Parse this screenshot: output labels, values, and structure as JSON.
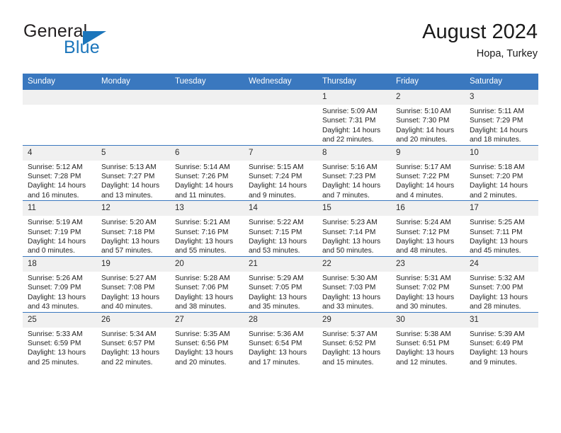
{
  "brand": {
    "line1": "General",
    "line2": "Blue",
    "accent_color": "#1b75bb"
  },
  "header": {
    "title": "August 2024",
    "location": "Hopa, Turkey"
  },
  "theme": {
    "header_bg": "#3a78bf",
    "daynum_bg": "#f0f0f0",
    "grid_line": "#3a78bf"
  },
  "calendar": {
    "weekday_headers": [
      "Sunday",
      "Monday",
      "Tuesday",
      "Wednesday",
      "Thursday",
      "Friday",
      "Saturday"
    ],
    "labels": {
      "sunrise": "Sunrise:",
      "sunset": "Sunset:",
      "daylight": "Daylight:"
    },
    "weeks": [
      [
        {
          "day": "",
          "empty": true,
          "sunrise": "",
          "sunset": "",
          "daylight_line1": "",
          "daylight_line2": ""
        },
        {
          "day": "",
          "empty": true,
          "sunrise": "",
          "sunset": "",
          "daylight_line1": "",
          "daylight_line2": ""
        },
        {
          "day": "",
          "empty": true,
          "sunrise": "",
          "sunset": "",
          "daylight_line1": "",
          "daylight_line2": ""
        },
        {
          "day": "",
          "empty": true,
          "sunrise": "",
          "sunset": "",
          "daylight_line1": "",
          "daylight_line2": ""
        },
        {
          "day": "1",
          "sunrise": "Sunrise: 5:09 AM",
          "sunset": "Sunset: 7:31 PM",
          "daylight_line1": "Daylight: 14 hours",
          "daylight_line2": "and 22 minutes."
        },
        {
          "day": "2",
          "sunrise": "Sunrise: 5:10 AM",
          "sunset": "Sunset: 7:30 PM",
          "daylight_line1": "Daylight: 14 hours",
          "daylight_line2": "and 20 minutes."
        },
        {
          "day": "3",
          "sunrise": "Sunrise: 5:11 AM",
          "sunset": "Sunset: 7:29 PM",
          "daylight_line1": "Daylight: 14 hours",
          "daylight_line2": "and 18 minutes."
        }
      ],
      [
        {
          "day": "4",
          "sunrise": "Sunrise: 5:12 AM",
          "sunset": "Sunset: 7:28 PM",
          "daylight_line1": "Daylight: 14 hours",
          "daylight_line2": "and 16 minutes."
        },
        {
          "day": "5",
          "sunrise": "Sunrise: 5:13 AM",
          "sunset": "Sunset: 7:27 PM",
          "daylight_line1": "Daylight: 14 hours",
          "daylight_line2": "and 13 minutes."
        },
        {
          "day": "6",
          "sunrise": "Sunrise: 5:14 AM",
          "sunset": "Sunset: 7:26 PM",
          "daylight_line1": "Daylight: 14 hours",
          "daylight_line2": "and 11 minutes."
        },
        {
          "day": "7",
          "sunrise": "Sunrise: 5:15 AM",
          "sunset": "Sunset: 7:24 PM",
          "daylight_line1": "Daylight: 14 hours",
          "daylight_line2": "and 9 minutes."
        },
        {
          "day": "8",
          "sunrise": "Sunrise: 5:16 AM",
          "sunset": "Sunset: 7:23 PM",
          "daylight_line1": "Daylight: 14 hours",
          "daylight_line2": "and 7 minutes."
        },
        {
          "day": "9",
          "sunrise": "Sunrise: 5:17 AM",
          "sunset": "Sunset: 7:22 PM",
          "daylight_line1": "Daylight: 14 hours",
          "daylight_line2": "and 4 minutes."
        },
        {
          "day": "10",
          "sunrise": "Sunrise: 5:18 AM",
          "sunset": "Sunset: 7:20 PM",
          "daylight_line1": "Daylight: 14 hours",
          "daylight_line2": "and 2 minutes."
        }
      ],
      [
        {
          "day": "11",
          "sunrise": "Sunrise: 5:19 AM",
          "sunset": "Sunset: 7:19 PM",
          "daylight_line1": "Daylight: 14 hours",
          "daylight_line2": "and 0 minutes."
        },
        {
          "day": "12",
          "sunrise": "Sunrise: 5:20 AM",
          "sunset": "Sunset: 7:18 PM",
          "daylight_line1": "Daylight: 13 hours",
          "daylight_line2": "and 57 minutes."
        },
        {
          "day": "13",
          "sunrise": "Sunrise: 5:21 AM",
          "sunset": "Sunset: 7:16 PM",
          "daylight_line1": "Daylight: 13 hours",
          "daylight_line2": "and 55 minutes."
        },
        {
          "day": "14",
          "sunrise": "Sunrise: 5:22 AM",
          "sunset": "Sunset: 7:15 PM",
          "daylight_line1": "Daylight: 13 hours",
          "daylight_line2": "and 53 minutes."
        },
        {
          "day": "15",
          "sunrise": "Sunrise: 5:23 AM",
          "sunset": "Sunset: 7:14 PM",
          "daylight_line1": "Daylight: 13 hours",
          "daylight_line2": "and 50 minutes."
        },
        {
          "day": "16",
          "sunrise": "Sunrise: 5:24 AM",
          "sunset": "Sunset: 7:12 PM",
          "daylight_line1": "Daylight: 13 hours",
          "daylight_line2": "and 48 minutes."
        },
        {
          "day": "17",
          "sunrise": "Sunrise: 5:25 AM",
          "sunset": "Sunset: 7:11 PM",
          "daylight_line1": "Daylight: 13 hours",
          "daylight_line2": "and 45 minutes."
        }
      ],
      [
        {
          "day": "18",
          "sunrise": "Sunrise: 5:26 AM",
          "sunset": "Sunset: 7:09 PM",
          "daylight_line1": "Daylight: 13 hours",
          "daylight_line2": "and 43 minutes."
        },
        {
          "day": "19",
          "sunrise": "Sunrise: 5:27 AM",
          "sunset": "Sunset: 7:08 PM",
          "daylight_line1": "Daylight: 13 hours",
          "daylight_line2": "and 40 minutes."
        },
        {
          "day": "20",
          "sunrise": "Sunrise: 5:28 AM",
          "sunset": "Sunset: 7:06 PM",
          "daylight_line1": "Daylight: 13 hours",
          "daylight_line2": "and 38 minutes."
        },
        {
          "day": "21",
          "sunrise": "Sunrise: 5:29 AM",
          "sunset": "Sunset: 7:05 PM",
          "daylight_line1": "Daylight: 13 hours",
          "daylight_line2": "and 35 minutes."
        },
        {
          "day": "22",
          "sunrise": "Sunrise: 5:30 AM",
          "sunset": "Sunset: 7:03 PM",
          "daylight_line1": "Daylight: 13 hours",
          "daylight_line2": "and 33 minutes."
        },
        {
          "day": "23",
          "sunrise": "Sunrise: 5:31 AM",
          "sunset": "Sunset: 7:02 PM",
          "daylight_line1": "Daylight: 13 hours",
          "daylight_line2": "and 30 minutes."
        },
        {
          "day": "24",
          "sunrise": "Sunrise: 5:32 AM",
          "sunset": "Sunset: 7:00 PM",
          "daylight_line1": "Daylight: 13 hours",
          "daylight_line2": "and 28 minutes."
        }
      ],
      [
        {
          "day": "25",
          "sunrise": "Sunrise: 5:33 AM",
          "sunset": "Sunset: 6:59 PM",
          "daylight_line1": "Daylight: 13 hours",
          "daylight_line2": "and 25 minutes."
        },
        {
          "day": "26",
          "sunrise": "Sunrise: 5:34 AM",
          "sunset": "Sunset: 6:57 PM",
          "daylight_line1": "Daylight: 13 hours",
          "daylight_line2": "and 22 minutes."
        },
        {
          "day": "27",
          "sunrise": "Sunrise: 5:35 AM",
          "sunset": "Sunset: 6:56 PM",
          "daylight_line1": "Daylight: 13 hours",
          "daylight_line2": "and 20 minutes."
        },
        {
          "day": "28",
          "sunrise": "Sunrise: 5:36 AM",
          "sunset": "Sunset: 6:54 PM",
          "daylight_line1": "Daylight: 13 hours",
          "daylight_line2": "and 17 minutes."
        },
        {
          "day": "29",
          "sunrise": "Sunrise: 5:37 AM",
          "sunset": "Sunset: 6:52 PM",
          "daylight_line1": "Daylight: 13 hours",
          "daylight_line2": "and 15 minutes."
        },
        {
          "day": "30",
          "sunrise": "Sunrise: 5:38 AM",
          "sunset": "Sunset: 6:51 PM",
          "daylight_line1": "Daylight: 13 hours",
          "daylight_line2": "and 12 minutes."
        },
        {
          "day": "31",
          "sunrise": "Sunrise: 5:39 AM",
          "sunset": "Sunset: 6:49 PM",
          "daylight_line1": "Daylight: 13 hours",
          "daylight_line2": "and 9 minutes."
        }
      ]
    ]
  }
}
